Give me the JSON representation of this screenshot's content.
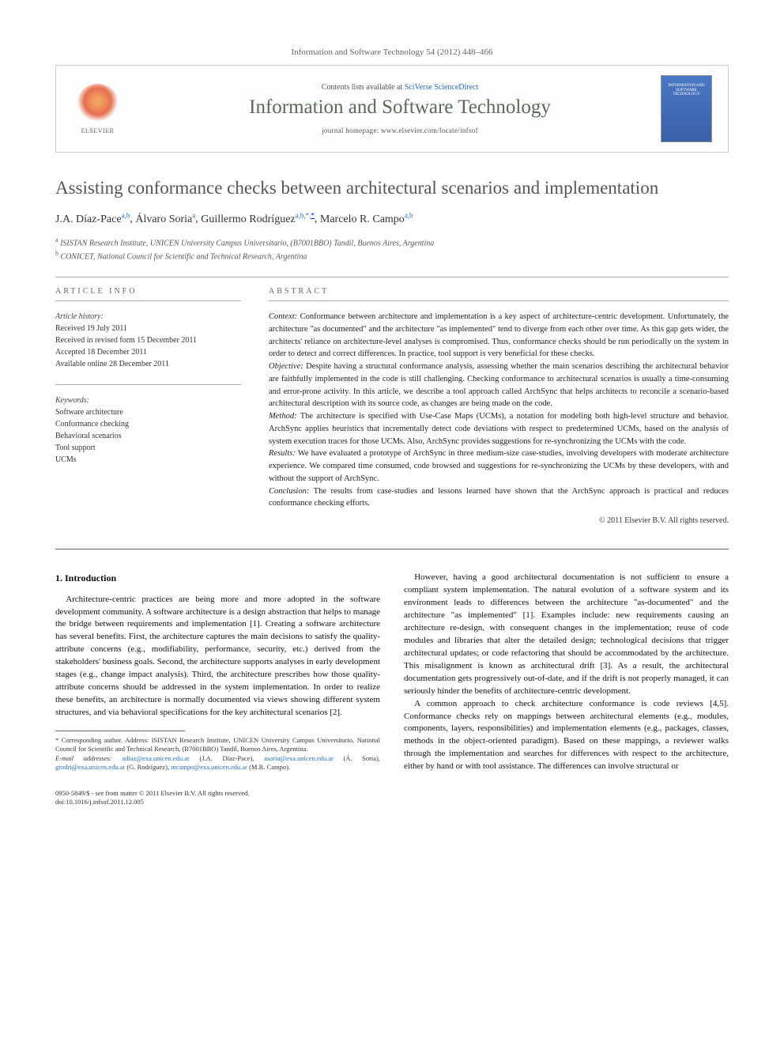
{
  "citation": "Information and Software Technology 54 (2012) 448–466",
  "header": {
    "contents_prefix": "Contents lists available at ",
    "contents_link": "SciVerse ScienceDirect",
    "journal_title": "Information and Software Technology",
    "homepage_prefix": "journal homepage: ",
    "homepage_url": "www.elsevier.com/locate/infsof",
    "publisher_name": "ELSEVIER"
  },
  "article": {
    "title": "Assisting conformance checks between architectural scenarios and implementation",
    "authors_html": "J.A. Díaz-Pace",
    "authors": [
      {
        "name": "J.A. Díaz-Pace",
        "affil": "a,b"
      },
      {
        "name": "Álvaro Soria",
        "affil": "a"
      },
      {
        "name": "Guillermo Rodríguez",
        "affil": "a,b,*"
      },
      {
        "name": "Marcelo R. Campo",
        "affil": "a,b"
      }
    ],
    "author_line": "J.A. Díaz-Pace a,b, Álvaro Soria a, Guillermo Rodríguez a,b,*, Marcelo R. Campo a,b",
    "affiliations": {
      "a": "ISISTAN Research Institute, UNICEN University Campus Universitario, (B7001BBO) Tandil, Buenos Aires, Argentina",
      "b": "CONICET, National Council for Scientific and Technical Research, Argentina"
    }
  },
  "info": {
    "heading": "ARTICLE INFO",
    "history_label": "Article history:",
    "history": [
      "Received 19 July 2011",
      "Received in revised form 15 December 2011",
      "Accepted 18 December 2011",
      "Available online 28 December 2011"
    ],
    "keywords_label": "Keywords:",
    "keywords": [
      "Software architecture",
      "Conformance checking",
      "Behavioral scenarios",
      "Tool support",
      "UCMs"
    ]
  },
  "abstract": {
    "heading": "ABSTRACT",
    "context_label": "Context:",
    "context": "Conformance between architecture and implementation is a key aspect of architecture-centric development. Unfortunately, the architecture \"as documented\" and the architecture \"as implemented\" tend to diverge from each other over time. As this gap gets wider, the architects' reliance on architecture-level analyses is compromised. Thus, conformance checks should be run periodically on the system in order to detect and correct differences. In practice, tool support is very beneficial for these checks.",
    "objective_label": "Objective:",
    "objective": "Despite having a structural conformance analysis, assessing whether the main scenarios describing the architectural behavior are faithfully implemented in the code is still challenging. Checking conformance to architectural scenarios is usually a time-consuming and error-prone activity. In this article, we describe a tool approach called ArchSync that helps architects to reconcile a scenario-based architectural description with its source code, as changes are being made on the code.",
    "method_label": "Method:",
    "method": "The architecture is specified with Use-Case Maps (UCMs), a notation for modeling both high-level structure and behavior. ArchSync applies heuristics that incrementally detect code deviations with respect to predetermined UCMs, based on the analysis of system execution traces for those UCMs. Also, ArchSync provides suggestions for re-synchronizing the UCMs with the code.",
    "results_label": "Results:",
    "results": "We have evaluated a prototype of ArchSync in three medium-size case-studies, involving developers with moderate architecture experience. We compared time consumed, code browsed and suggestions for re-synchronizing the UCMs by these developers, with and without the support of ArchSync.",
    "conclusion_label": "Conclusion:",
    "conclusion": "The results from case-studies and lessons learned have shown that the ArchSync approach is practical and reduces conformance checking efforts.",
    "copyright": "© 2011 Elsevier B.V. All rights reserved."
  },
  "body": {
    "section1_heading": "1. Introduction",
    "para1": "Architecture-centric practices are being more and more adopted in the software development community. A software architecture is a design abstraction that helps to manage the bridge between requirements and implementation [1]. Creating a software architecture has several benefits. First, the architecture captures the main decisions to satisfy the quality-attribute concerns (e.g., modifiability, performance, security, etc.) derived from the stakeholders' business goals. Second, the architecture supports analyses in early development stages (e.g., change impact analysis). Third, the architecture prescribes how those quality-attribute concerns should be addressed in the system implementation. In order to realize these benefits, an architecture is normally documented via views showing different system structures, and via behavioral specifications for the key architectural scenarios [2].",
    "para2": "However, having a good architectural documentation is not sufficient to ensure a compliant system implementation. The natural evolution of a software system and its environment leads to differences between the architecture \"as-documented\" and the architecture \"as implemented\" [1]. Examples include: new requirements causing an architecture re-design, with consequent changes in the implementation; reuse of code modules and libraries that alter the detailed design; technological decisions that trigger architectural updates; or code refactoring that should be accommodated by the architecture. This misalignment is known as architectural drift [3]. As a result, the architectural documentation gets progressively out-of-date, and if the drift is not properly managed, it can seriously hinder the benefits of architecture-centric development.",
    "para3": "A common approach to check architecture conformance is code reviews [4,5]. Conformance checks rely on mappings between architectural elements (e.g., modules, components, layers, responsibilities) and implementation elements (e.g., packages, classes, methods in the object-oriented paradigm). Based on these mappings, a reviewer walks through the implementation and searches for differences with respect to the architecture, either by hand or with tool assistance. The differences can involve structural or"
  },
  "footnotes": {
    "corresponding": "* Corresponding author. Address: ISISTAN Research Institute, UNICEN University Campus Universitario, National Council for Scientific and Technical Research, (B7001BBO) Tandil, Buenos Aires, Argentina.",
    "emails_label": "E-mail addresses:",
    "emails": [
      {
        "email": "adiaz@exa.unicen.edu.ar",
        "person": "(J.A. Díaz-Pace)"
      },
      {
        "email": "asoria@exa.unicen.edu.ar",
        "person": "(Á. Soria)"
      },
      {
        "email": "grodri@exa.unicen.edu.ar",
        "person": "(G. Rodríguez)"
      },
      {
        "email": "mcampo@exa.unicen.edu.ar",
        "person": "(M.R. Campo)"
      }
    ]
  },
  "footer": {
    "line1": "0950-5849/$ - see front matter © 2011 Elsevier B.V. All rights reserved.",
    "line2": "doi:10.1016/j.infsof.2011.12.005"
  }
}
